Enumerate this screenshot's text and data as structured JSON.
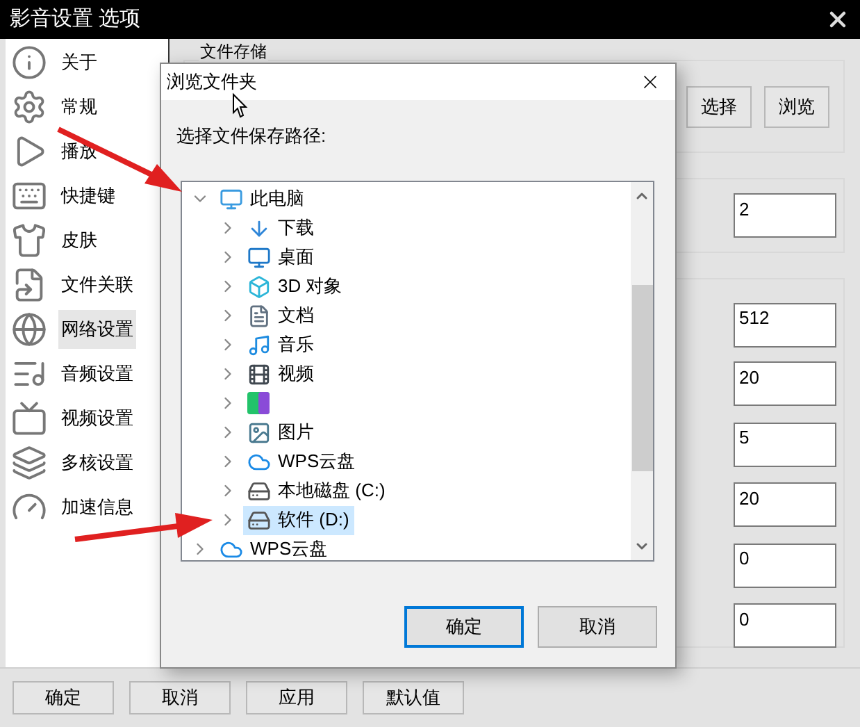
{
  "window": {
    "title": "影音设置 选项"
  },
  "sidebar": {
    "items": [
      {
        "label": "关于",
        "kind": "info",
        "selected": false
      },
      {
        "label": "常规",
        "kind": "gear",
        "selected": false
      },
      {
        "label": "播放",
        "kind": "play",
        "selected": false
      },
      {
        "label": "快捷键",
        "kind": "keyboard",
        "selected": false
      },
      {
        "label": "皮肤",
        "kind": "shirt",
        "selected": false
      },
      {
        "label": "文件关联",
        "kind": "file",
        "selected": false
      },
      {
        "label": "网络设置",
        "kind": "globe",
        "selected": true
      },
      {
        "label": "音频设置",
        "kind": "audio",
        "selected": false
      },
      {
        "label": "视频设置",
        "kind": "tv",
        "selected": false
      },
      {
        "label": "多核设置",
        "kind": "cores",
        "selected": false
      },
      {
        "label": "加速信息",
        "kind": "gauge",
        "selected": false
      }
    ]
  },
  "settings": {
    "file_storage": {
      "title": "文件存储",
      "buttons": [
        "选择",
        "浏览"
      ]
    },
    "single_field": {
      "value": "2"
    },
    "fields": [
      {
        "value": "512"
      },
      {
        "value": "20"
      },
      {
        "value": "5"
      },
      {
        "value": "20"
      },
      {
        "value": "0"
      },
      {
        "value": "0"
      }
    ]
  },
  "footer_buttons": [
    "确定",
    "取消",
    "应用",
    "默认值"
  ],
  "dialog": {
    "title": "浏览文件夹",
    "prompt": "选择文件保存路径:",
    "tree": [
      {
        "label": "此电脑",
        "kind": "pc",
        "expanded": true,
        "selected": false,
        "children": [
          {
            "label": "下载",
            "kind": "download",
            "expanded": false,
            "selected": false
          },
          {
            "label": "桌面",
            "kind": "desktop",
            "expanded": false,
            "selected": false
          },
          {
            "label": "3D 对象",
            "kind": "objects",
            "expanded": false,
            "selected": false
          },
          {
            "label": "文档",
            "kind": "document",
            "expanded": false,
            "selected": false
          },
          {
            "label": "音乐",
            "kind": "music",
            "expanded": false,
            "selected": false
          },
          {
            "label": "视频",
            "kind": "video",
            "expanded": false,
            "selected": false
          },
          {
            "kind": "app",
            "expanded": false,
            "selected": false
          },
          {
            "label": "图片",
            "kind": "pictures",
            "expanded": false,
            "selected": false
          },
          {
            "label": "WPS云盘",
            "kind": "cloud",
            "expanded": false,
            "selected": false
          },
          {
            "label": "本地磁盘 (C:)",
            "kind": "system-drive",
            "expanded": false,
            "selected": false
          },
          {
            "label": "软件 (D:)",
            "kind": "drive",
            "expanded": false,
            "selected": true
          }
        ]
      },
      {
        "label": "WPS云盘",
        "kind": "cloud",
        "expanded": false,
        "selected": false
      }
    ],
    "buttons": [
      {
        "label": "确定",
        "default": true
      },
      {
        "label": "取消",
        "default": false
      }
    ]
  }
}
